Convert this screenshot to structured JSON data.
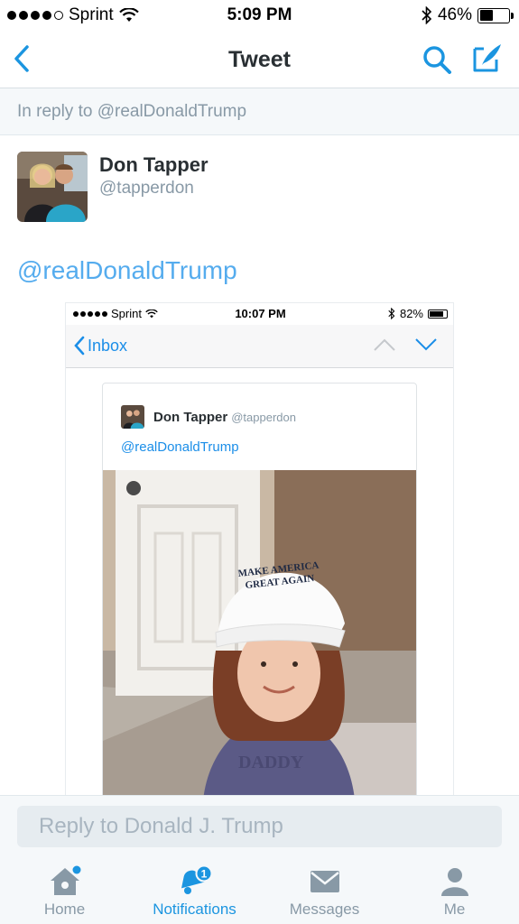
{
  "status_bar": {
    "carrier": "Sprint",
    "time": "5:09 PM",
    "battery": "46%",
    "battery_level": 0.46
  },
  "nav": {
    "title": "Tweet"
  },
  "reply_context": "In reply to @realDonaldTrump",
  "author": {
    "name": "Don Tapper",
    "handle": "@tapperdon"
  },
  "tweet_text": "@realDonaldTrump",
  "media": {
    "status_bar": {
      "carrier": "Sprint",
      "time": "10:07 PM",
      "battery": "82%",
      "battery_level": 0.82
    },
    "nav_back": "Inbox",
    "card": {
      "name": "Don Tapper",
      "handle": "@tapperdon",
      "text": "@realDonaldTrump"
    },
    "photo_caption_text": "MAKE AMERICA GREAT AGAIN"
  },
  "reply_bar": {
    "placeholder": "Reply to Donald J. Trump"
  },
  "tabs": [
    {
      "label": "Home",
      "icon": "home-icon",
      "active": false
    },
    {
      "label": "Notifications",
      "icon": "notifications-bell-icon",
      "active": true,
      "badge": "1"
    },
    {
      "label": "Messages",
      "icon": "envelope-icon",
      "active": false
    },
    {
      "label": "Me",
      "icon": "person-icon",
      "active": false
    }
  ],
  "colors": {
    "accent": "#1b95e0",
    "link": "#55acee",
    "muted": "#8899a6"
  }
}
